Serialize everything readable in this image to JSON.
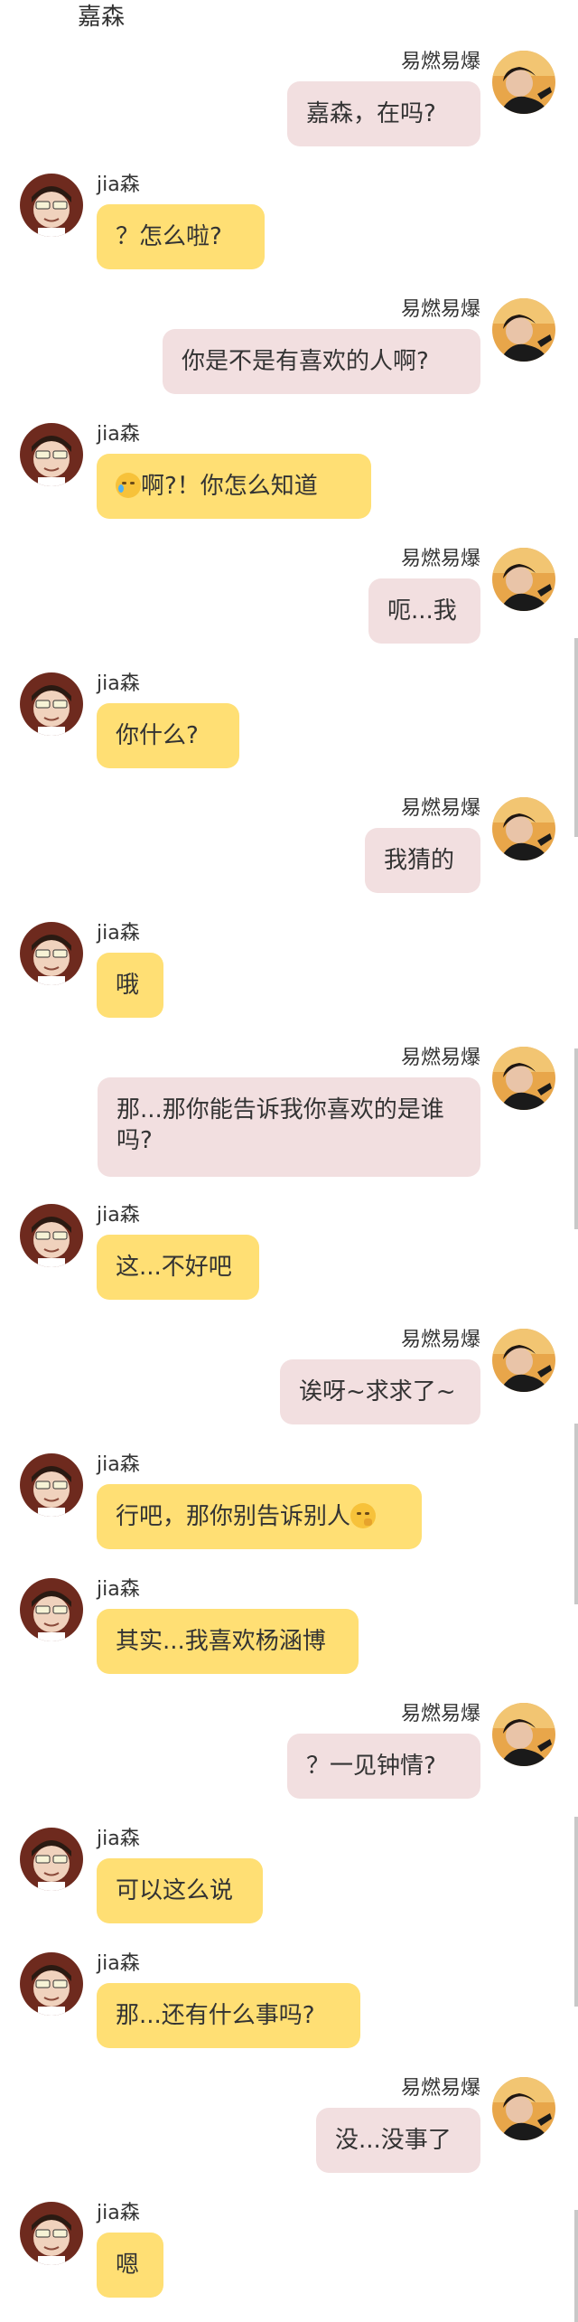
{
  "header": {
    "title": "嘉森"
  },
  "contacts": {
    "self_name": "易燃易爆",
    "other_name": "jia森"
  },
  "messages": [
    {
      "side": "right",
      "sender": "易燃易爆",
      "text": "嘉森，在吗?"
    },
    {
      "side": "left",
      "sender": "jia森",
      "text": "？怎么啦?"
    },
    {
      "side": "right",
      "sender": "易燃易爆",
      "text": "你是不是有喜欢的人啊?"
    },
    {
      "side": "left",
      "sender": "jia森",
      "emoji_before": "crying-face-icon",
      "text": "啊?！你怎么知道"
    },
    {
      "side": "right",
      "sender": "易燃易爆",
      "text": "呃...我"
    },
    {
      "side": "left",
      "sender": "jia森",
      "text": "你什么?"
    },
    {
      "side": "right",
      "sender": "易燃易爆",
      "text": "我猜的"
    },
    {
      "side": "left",
      "sender": "jia森",
      "text": "哦"
    },
    {
      "side": "right",
      "sender": "易燃易爆",
      "text": "那...那你能告诉我你喜欢的是谁吗?"
    },
    {
      "side": "left",
      "sender": "jia森",
      "text": "这...不好吧"
    },
    {
      "side": "right",
      "sender": "易燃易爆",
      "text": "诶呀~求求了~"
    },
    {
      "side": "left",
      "sender": "jia森",
      "text": "行吧，那你别告诉别人",
      "emoji_after": "shushing-face-icon"
    },
    {
      "side": "left",
      "sender": "jia森",
      "text": "其实...我喜欢杨涵博"
    },
    {
      "side": "right",
      "sender": "易燃易爆",
      "text": "？一见钟情?"
    },
    {
      "side": "left",
      "sender": "jia森",
      "text": "可以这么说"
    },
    {
      "side": "left",
      "sender": "jia森",
      "text": "那...还有什么事吗?"
    },
    {
      "side": "right",
      "sender": "易燃易爆",
      "text": "没...没事了"
    },
    {
      "side": "left",
      "sender": "jia森",
      "text": "嗯"
    }
  ],
  "colors": {
    "left_bubble": "#ffdf74",
    "right_bubble": "#f2dfe0",
    "background": "#ffffff"
  }
}
